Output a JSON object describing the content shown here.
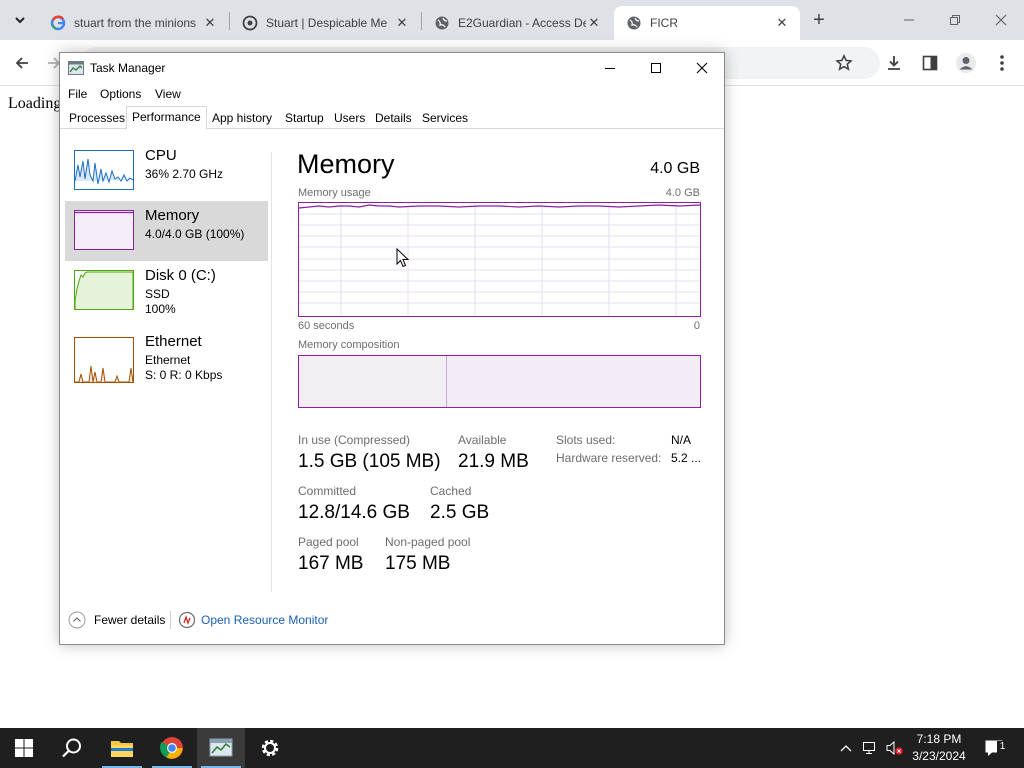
{
  "browser": {
    "tabs": [
      {
        "title": "stuart from the minions",
        "favicon": "google-g-icon"
      },
      {
        "title": "Stuart | Despicable Me",
        "favicon": "site-icon"
      },
      {
        "title": "E2Guardian - Access Denied",
        "favicon": "globe-icon"
      },
      {
        "title": "FICR",
        "favicon": "globe-icon",
        "active": true
      }
    ],
    "page_text": "Loading"
  },
  "task_manager": {
    "title": "Task Manager",
    "menu": [
      "File",
      "Options",
      "View"
    ],
    "tabs": [
      "Processes",
      "Performance",
      "App history",
      "Startup",
      "Users",
      "Details",
      "Services"
    ],
    "active_tab": "Performance",
    "sidebar": [
      {
        "name": "CPU",
        "sub1": "36% 2.70 GHz",
        "sub2": "",
        "color": "#1a6fc4"
      },
      {
        "name": "Memory",
        "sub1": "4.0/4.0 GB (100%)",
        "sub2": "",
        "color": "#8b1fa0",
        "selected": true
      },
      {
        "name": "Disk 0 (C:)",
        "sub1": "SSD",
        "sub2": "100%",
        "color": "#4da60c"
      },
      {
        "name": "Ethernet",
        "sub1": "Ethernet",
        "sub2": "S: 0 R: 0 Kbps",
        "color": "#a74f01"
      }
    ],
    "main": {
      "title": "Memory",
      "total": "4.0 GB",
      "usage_label": "Memory usage",
      "usage_max": "4.0 GB",
      "axis_left": "60 seconds",
      "axis_right": "0",
      "composition_label": "Memory composition",
      "composition_in_use_fraction": 0.37,
      "stats": {
        "in_use_label": "In use (Compressed)",
        "in_use_value": "1.5 GB (105 MB)",
        "available_label": "Available",
        "available_value": "21.9 MB",
        "committed_label": "Committed",
        "committed_value": "12.8/14.6 GB",
        "cached_label": "Cached",
        "cached_value": "2.5 GB",
        "paged_label": "Paged pool",
        "paged_value": "167 MB",
        "nonpaged_label": "Non-paged pool",
        "nonpaged_value": "175 MB",
        "slots_label": "Slots used:",
        "slots_value": "N/A",
        "hw_label": "Hardware reserved:",
        "hw_value": "5.2 ..."
      }
    },
    "footer": {
      "fewer_details": "Fewer details",
      "resource_monitor": "Open Resource Monitor"
    }
  },
  "taskbar": {
    "time": "7:18 PM",
    "date": "3/23/2024",
    "notification_count": "1"
  }
}
